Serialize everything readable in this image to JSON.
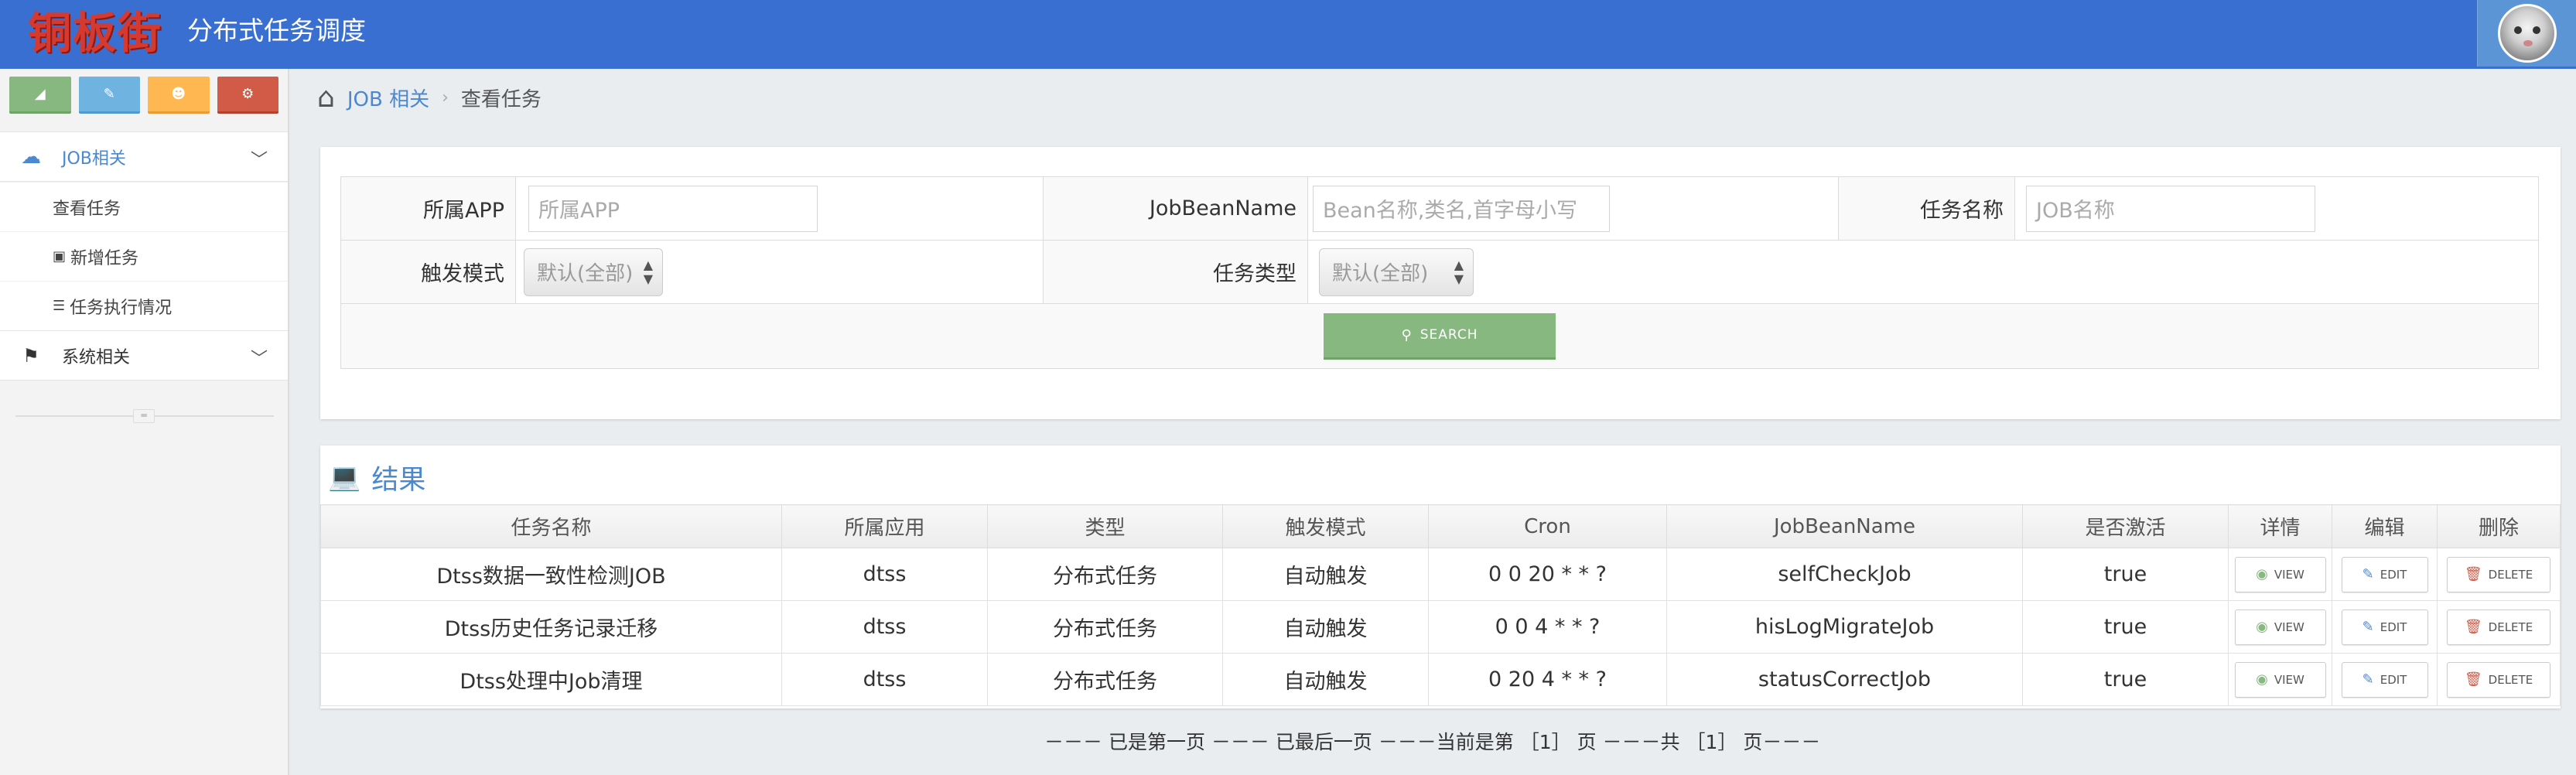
{
  "header": {
    "logo_text": "铜板街",
    "app_title": "分布式任务调度"
  },
  "colors": {
    "navbar": "#3a6fd2",
    "accent_blue": "#4b88d0",
    "green": "#87b87f",
    "orange": "#ffb752",
    "red": "#d15b47",
    "light_blue": "#6fb3e0"
  },
  "shortcuts": [
    {
      "icon": "signal-icon"
    },
    {
      "icon": "pencil-icon"
    },
    {
      "icon": "users-icon"
    },
    {
      "icon": "cogs-icon"
    }
  ],
  "sidebar": {
    "job_group": {
      "label": "JOB相关",
      "icon": "cloud-icon"
    },
    "job_items": [
      {
        "label": "查看任务",
        "icon": ""
      },
      {
        "label": "新增任务",
        "icon": "save-icon"
      },
      {
        "label": "任务执行情况",
        "icon": "list-icon"
      }
    ],
    "system_group": {
      "label": "系统相关",
      "icon": "flag-icon"
    }
  },
  "breadcrumb": {
    "parent": "JOB 相关",
    "current": "查看任务"
  },
  "search_form": {
    "app_label": "所属APP",
    "app_placeholder": "所属APP",
    "bean_label": "JobBeanName",
    "bean_placeholder": "Bean名称,类名,首字母小写",
    "name_label": "任务名称",
    "name_placeholder": "JOB名称",
    "trigger_label": "触发模式",
    "trigger_value": "默认(全部)",
    "type_label": "任务类型",
    "type_value": "默认(全部)",
    "search_label": "SEARCH"
  },
  "results": {
    "title": "结果",
    "columns": [
      "任务名称",
      "所属应用",
      "类型",
      "触发模式",
      "Cron",
      "JobBeanName",
      "是否激活",
      "详情",
      "编辑",
      "删除"
    ],
    "view_label": "VIEW",
    "edit_label": "EDIT",
    "delete_label": "DELETE",
    "rows": [
      {
        "name": "Dtss数据一致性检测JOB",
        "app": "dtss",
        "type": "分布式任务",
        "trigger": "自动触发",
        "cron": "0 0 20 * * ?",
        "bean": "selfCheckJob",
        "active": "true"
      },
      {
        "name": "Dtss历史任务记录迁移",
        "app": "dtss",
        "type": "分布式任务",
        "trigger": "自动触发",
        "cron": "0 0 4 * * ?",
        "bean": "hisLogMigrateJob",
        "active": "true"
      },
      {
        "name": "Dtss处理中Job清理",
        "app": "dtss",
        "type": "分布式任务",
        "trigger": "自动触发",
        "cron": "0 20 4 * * ?",
        "bean": "statusCorrectJob",
        "active": "true"
      }
    ]
  },
  "pager": {
    "text": "－－－ 已是第一页 －－－ 已最后一页 －－－当前是第 ［1］ 页 －－－共 ［1］ 页－－－"
  }
}
